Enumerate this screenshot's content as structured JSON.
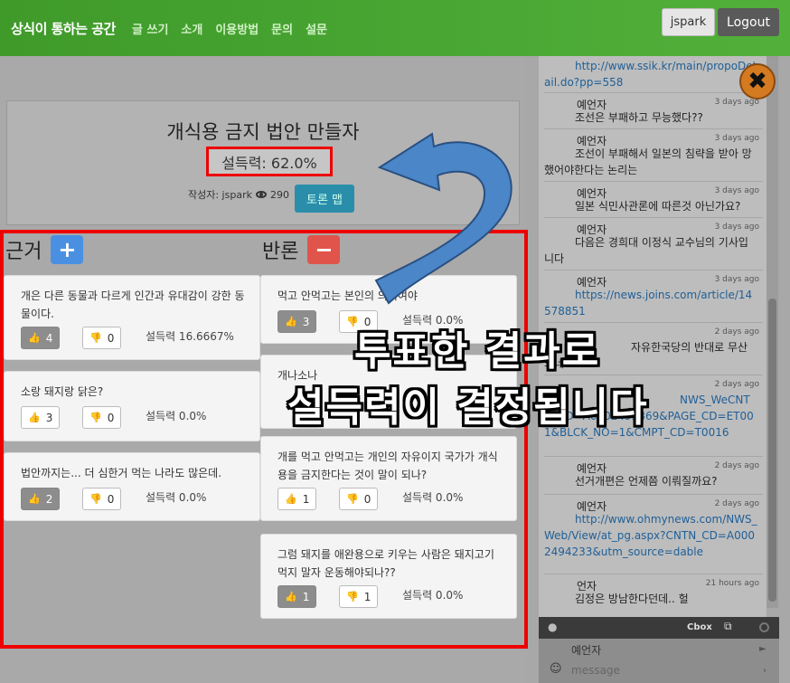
{
  "navbar": {
    "brand": "상식이 통하는 공간",
    "links": [
      "글 쓰기",
      "소개",
      "이용방법",
      "문의",
      "설문"
    ],
    "user": "jspark",
    "logout": "Logout"
  },
  "topic": {
    "title": "개식용 금지 법안 만들자",
    "score_label": "설득력: 62.0%",
    "author_label": "작성자: jspark",
    "views": "290",
    "discuss_button": "토론 맵"
  },
  "columns": {
    "pro_label": "근거",
    "con_label": "반론",
    "plus": "+",
    "minus": "−"
  },
  "pro_cards": [
    {
      "text": "개은 다른 동물과 다르게 인간과 유대감이 강한 동물이다.",
      "up": "4",
      "down": "0",
      "score": "설득력 16.6667%",
      "up_active": true
    },
    {
      "text": "소랑 돼지랑 닭은?",
      "up": "3",
      "down": "0",
      "score": "설득력 0.0%",
      "up_active": false
    },
    {
      "text": "법안까지는... 더 심한거 먹는 나라도 많은데.",
      "up": "2",
      "down": "0",
      "score": "설득력 0.0%",
      "up_active": true
    }
  ],
  "con_cards": [
    {
      "text": "먹고 안먹고는 본인의 의지여야",
      "up": "3",
      "down": "0",
      "score": "설득력 0.0%",
      "up_active": true
    },
    {
      "text": "개나소나",
      "up": "",
      "down": "",
      "score": "",
      "up_active": false
    },
    {
      "text": "개를 먹고 안먹고는 개인의 자유이지 국가가 개식용을 금지한다는 것이 말이 되나?",
      "up": "1",
      "down": "0",
      "score": "설득력 0.0%",
      "up_active": false
    },
    {
      "text": "그럼 돼지를 애완용으로 키우는 사람은 돼지고기 먹지 말자 운동해야되나??",
      "up": "1",
      "down": "1",
      "score": "설득력 0.0%",
      "up_active": true
    }
  ],
  "chat": {
    "messages": [
      {
        "user": "",
        "time": "",
        "text": "http://www.ssik.kr/main/propoDetail.do?pp=558",
        "link": true
      },
      {
        "user": "예언자",
        "time": "3 days ago",
        "text": "조선은 부패하고 무능했다??",
        "link": false
      },
      {
        "user": "예언자",
        "time": "3 days ago",
        "text": "조선이 부패해서 일본의 침략을 받아 망했어야한다는 논리는",
        "link": false
      },
      {
        "user": "예언자",
        "time": "3 days ago",
        "text": "일본 식민사관론에 따른것 아닌가요?",
        "link": false
      },
      {
        "user": "예언자",
        "time": "3 days ago",
        "text": "다음은 경희대 이정식 교수님의 기사입니다",
        "link": false
      },
      {
        "user": "예언자",
        "time": "3 days ago",
        "text": "https://news.joins.com/article/14578851",
        "link": true
      },
      {
        "user": "",
        "time": "2 days ago",
        "text": "자유한국당의 반대로 무산되네",
        "link": false
      },
      {
        "user": "",
        "time": "2 days ago",
        "text": "NWS_WeCNTN_CD=A0002493869&PAGE_CD=ET001&BLCK_NO=1&CMPT_CD=T0016",
        "link": true
      },
      {
        "user": "예언자",
        "time": "2 days ago",
        "text": "선거개편은 언제쯤 이뤄질까요?",
        "link": false
      },
      {
        "user": "예언자",
        "time": "2 days ago",
        "text": "http://www.ohmynews.com/NWS_Web/View/at_pg.aspx?CNTN_CD=A0002494233&utm_source=dable",
        "link": true
      },
      {
        "user": "언자",
        "time": "21 hours ago",
        "text": "김정은 방남한다던데.. 헐",
        "link": false
      }
    ],
    "footer_brand": "Cbox",
    "name_value": "예언자",
    "message_placeholder": "message"
  },
  "overlay": {
    "line1": "투표한 결과로",
    "line2": "설득력이 결정됩니다",
    "close": "✖"
  }
}
